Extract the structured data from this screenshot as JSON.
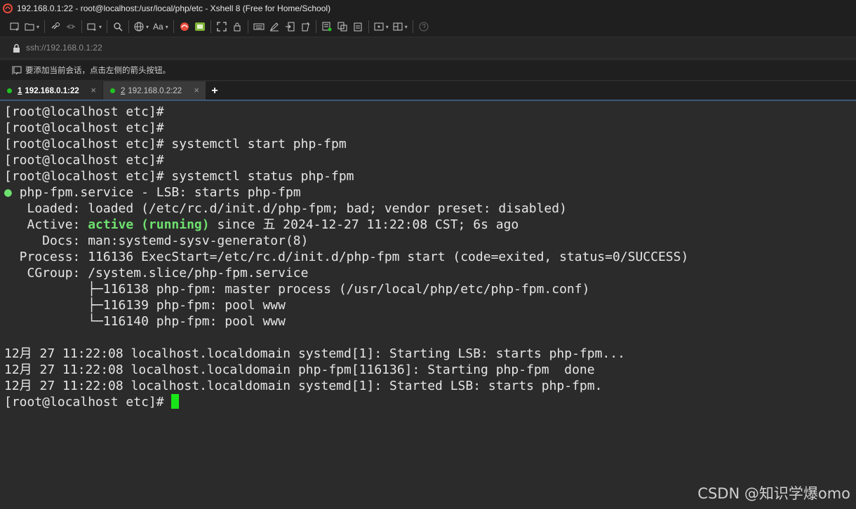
{
  "window": {
    "title": "192.168.0.1:22 - root@localhost:/usr/local/php/etc - Xshell 8 (Free for Home/School)"
  },
  "toolbar": {
    "icons": [
      "new-session-icon",
      "open-folder-icon",
      "connect-icon",
      "disconnect-icon",
      "new-window-icon",
      "search-icon",
      "globe-icon",
      "font-icon",
      "xshell-logo-icon",
      "xftp-icon",
      "fullscreen-icon",
      "lock-icon",
      "keyboard-icon",
      "compose-icon",
      "transfer-icon",
      "script-icon",
      "log-icon",
      "copy-icon",
      "paste-icon",
      "new-tab-icon",
      "layout-icon",
      "help-icon"
    ],
    "font_label": "Aa"
  },
  "address": {
    "value": "ssh://192.168.0.1:22"
  },
  "hint": {
    "text": "要添加当前会话，点击左侧的箭头按钮。"
  },
  "tabs": [
    {
      "num": "1",
      "label": "192.168.0.1:22",
      "active": true
    },
    {
      "num": "2",
      "label": "192.168.0.2:22",
      "active": false
    }
  ],
  "terminal": {
    "lines": [
      "[root@localhost etc]#",
      "[root@localhost etc]#",
      "[root@localhost etc]# systemctl start php-fpm",
      "[root@localhost etc]#",
      "[root@localhost etc]# systemctl status php-fpm"
    ],
    "status": {
      "service_line": "php-fpm.service - LSB: starts php-fpm",
      "loaded": "   Loaded: loaded (/etc/rc.d/init.d/php-fpm; bad; vendor preset: disabled)",
      "active_prefix": "   Active: ",
      "active_state": "active (running)",
      "active_suffix": " since 五 2024-12-27 11:22:08 CST; 6s ago",
      "docs": "     Docs: man:systemd-sysv-generator(8)",
      "process": "  Process: 116136 ExecStart=/etc/rc.d/init.d/php-fpm start (code=exited, status=0/SUCCESS)",
      "cgroup": "   CGroup: /system.slice/php-fpm.service",
      "children": [
        "           ├─116138 php-fpm: master process (/usr/local/php/etc/php-fpm.conf)",
        "           ├─116139 php-fpm: pool www",
        "           └─116140 php-fpm: pool www"
      ]
    },
    "log": [
      "12月 27 11:22:08 localhost.localdomain systemd[1]: Starting LSB: starts php-fpm...",
      "12月 27 11:22:08 localhost.localdomain php-fpm[116136]: Starting php-fpm  done",
      "12月 27 11:22:08 localhost.localdomain systemd[1]: Started LSB: starts php-fpm."
    ],
    "prompt": "[root@localhost etc]# "
  },
  "watermark": "CSDN @知识学爆omo",
  "colors": {
    "terminal_bg": "#2b2b2b",
    "active_green": "#6ee06e",
    "cursor": "#19e619"
  }
}
